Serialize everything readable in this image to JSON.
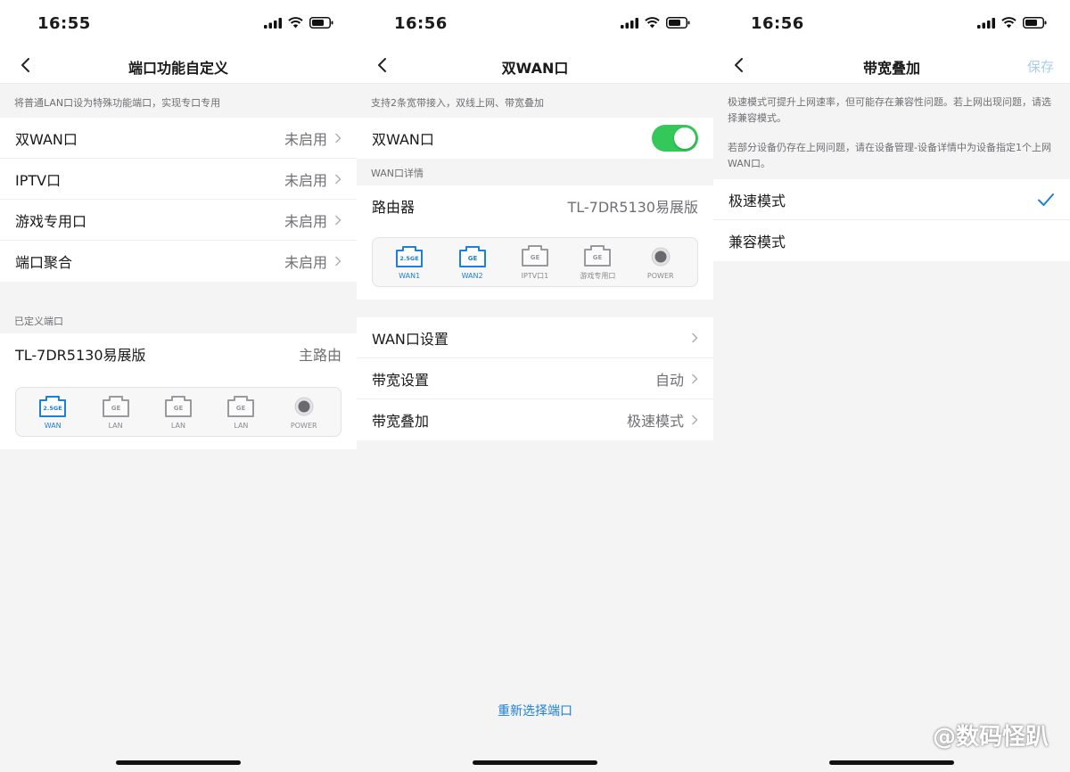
{
  "screens": [
    {
      "status_time": "16:55",
      "title": "端口功能自定义",
      "hint": "将普通LAN口设为特殊功能端口，实现专口专用",
      "rows": [
        {
          "label": "双WAN口",
          "value": "未启用"
        },
        {
          "label": "IPTV口",
          "value": "未启用"
        },
        {
          "label": "游戏专用口",
          "value": "未启用"
        },
        {
          "label": "端口聚合",
          "value": "未启用"
        }
      ],
      "section_title": "已定义端口",
      "device_row": {
        "label": "TL-7DR5130易展版",
        "value": "主路由"
      },
      "ports": [
        {
          "chip": "2.5GE",
          "label": "WAN",
          "active": true
        },
        {
          "chip": "GE",
          "label": "LAN",
          "active": false
        },
        {
          "chip": "GE",
          "label": "LAN",
          "active": false
        },
        {
          "chip": "GE",
          "label": "LAN",
          "active": false
        },
        {
          "chip": "",
          "label": "POWER",
          "active": false
        }
      ]
    },
    {
      "status_time": "16:56",
      "title": "双WAN口",
      "hint": "支持2条宽带接入，双线上网、带宽叠加",
      "toggle_row": {
        "label": "双WAN口",
        "on": true
      },
      "section_title": "WAN口详情",
      "device_row": {
        "label": "路由器",
        "value": "TL-7DR5130易展版"
      },
      "ports": [
        {
          "chip": "2.5GE",
          "label": "WAN1",
          "active": true
        },
        {
          "chip": "GE",
          "label": "WAN2",
          "active": true
        },
        {
          "chip": "GE",
          "label": "IPTV口1",
          "active": false
        },
        {
          "chip": "GE",
          "label": "游戏专用口",
          "active": false
        },
        {
          "chip": "",
          "label": "POWER",
          "active": false
        }
      ],
      "settings_rows": [
        {
          "label": "WAN口设置",
          "value": ""
        },
        {
          "label": "带宽设置",
          "value": "自动"
        },
        {
          "label": "带宽叠加",
          "value": "极速模式"
        }
      ],
      "reselect_link": "重新选择端口"
    },
    {
      "status_time": "16:56",
      "title": "带宽叠加",
      "save_label": "保存",
      "hint1": "极速模式可提升上网速率，但可能存在兼容性问题。若上网出现问题，请选择兼容模式。",
      "hint2": "若部分设备仍存在上网问题，请在设备管理-设备详情中为设备指定1个上网WAN口。",
      "options": [
        {
          "label": "极速模式",
          "selected": true
        },
        {
          "label": "兼容模式",
          "selected": false
        }
      ],
      "watermark": "@数码怪趴"
    }
  ],
  "colors": {
    "accent_blue": "#1c7fd8",
    "toggle_green": "#34c759",
    "save_disabled": "#a9cdee"
  }
}
